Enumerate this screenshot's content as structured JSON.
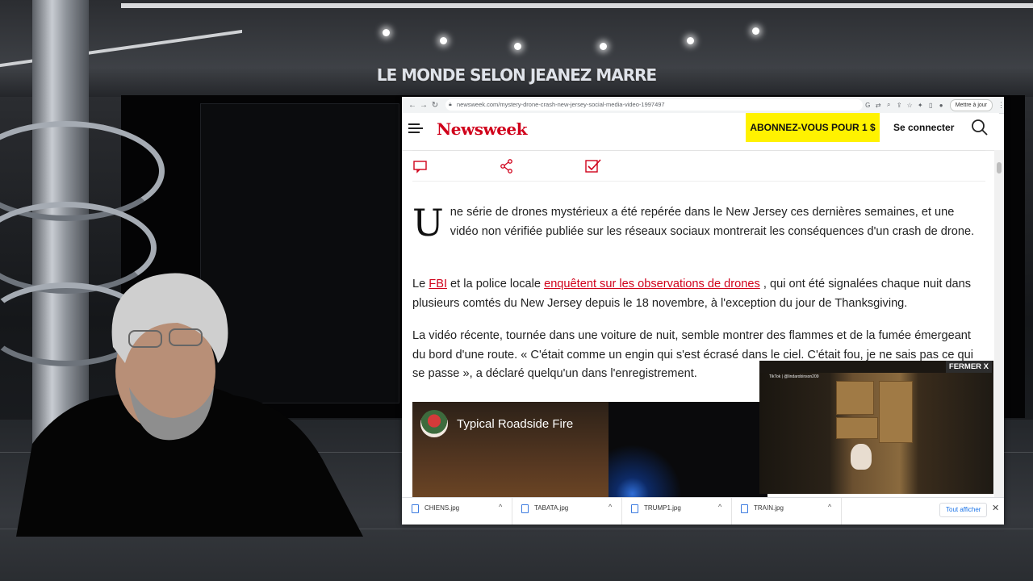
{
  "overlay": {
    "show_title": "LE MONDE SELON JEANEZ MARRE"
  },
  "browser": {
    "url": "newsweek.com/mystery-drone-crash-new-jersey-social-media-video-1997497",
    "update_button": "Mettre à jour",
    "nav_icons": [
      "back-icon",
      "forward-icon",
      "reload-icon"
    ]
  },
  "site": {
    "logo": "Newsweek",
    "subscribe": "ABONNEZ-VOUS POUR 1 $",
    "login": "Se connecter"
  },
  "article": {
    "dropcap": "U",
    "p1": "ne série de drones mystérieux a été repérée dans le New Jersey ces dernières semaines, et une vidéo non vérifiée publiée sur les réseaux sociaux montrerait les conséquences d'un crash de drone.",
    "p2_start": "Le ",
    "p2_link1": "FBI",
    "p2_mid": " et la police locale ",
    "p2_link2": "enquêtent sur les observations de drones",
    "p2_end": " , qui ont été signalées chaque nuit dans plusieurs comtés du New Jersey depuis le 18 novembre, à l'exception du jour de Thanksgiving.",
    "p3": "La vidéo récente, tournée dans une voiture de nuit, semble montrer des flammes et de la fumée émergeant du bord d'une route. « C'était comme un engin qui s'est écrasé dans le ciel. C'était fou, je ne sais pas ce qui se passe », a déclaré quelqu'un dans l'enregistrement."
  },
  "embed": {
    "title": "Typical Roadside Fire"
  },
  "pip": {
    "close_label": "FERMER X",
    "tag": "TikTok | @lindarobinson209"
  },
  "downloads": {
    "items": [
      "CHIENS.jpg",
      "TABATA.jpg",
      "TRUMP1.jpg",
      "TRAIN.jpg"
    ],
    "show_all": "Tout afficher"
  },
  "colors": {
    "brand_red": "#d0021b",
    "subscribe_yellow": "#fff200",
    "link_red": "#d0021b"
  }
}
